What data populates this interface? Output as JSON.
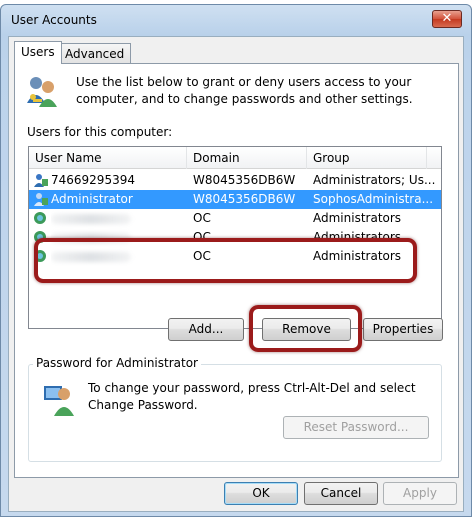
{
  "window": {
    "title": "User Accounts",
    "close_label": "✕"
  },
  "tabs": [
    {
      "label": "Users",
      "active": true
    },
    {
      "label": "Advanced",
      "active": false
    }
  ],
  "intro": {
    "text": "Use the list below to grant or deny users access to your computer, and to change passwords and other settings."
  },
  "users_label": "Users for this computer:",
  "list": {
    "columns": [
      "User Name",
      "Domain",
      "Group"
    ],
    "rows": [
      {
        "user": "74669295394",
        "domain": "W8045356DB6W",
        "group": "Administrators; Us...",
        "selected": false,
        "redacted": false
      },
      {
        "user": "Administrator",
        "domain": "W8045356DB6W",
        "group": "SophosAdministra...",
        "selected": true,
        "redacted": false
      },
      {
        "user": "",
        "domain": "OC",
        "group": "Administrators",
        "selected": false,
        "redacted": true
      },
      {
        "user": "",
        "domain": "OC",
        "group": "Administrators",
        "selected": false,
        "redacted": true
      },
      {
        "user": "",
        "domain": "OC",
        "group": "Administrators",
        "selected": false,
        "redacted": true
      }
    ]
  },
  "buttons": {
    "add": "Add...",
    "remove": "Remove",
    "properties": "Properties",
    "reset_password": "Reset Password...",
    "ok": "OK",
    "cancel": "Cancel",
    "apply": "Apply"
  },
  "password_group": {
    "legend": "Password for Administrator",
    "text": "To change your password, press Ctrl-Alt-Del and select Change Password."
  },
  "colors": {
    "highlight": "#9b1b1b",
    "selection": "#3399ff"
  }
}
